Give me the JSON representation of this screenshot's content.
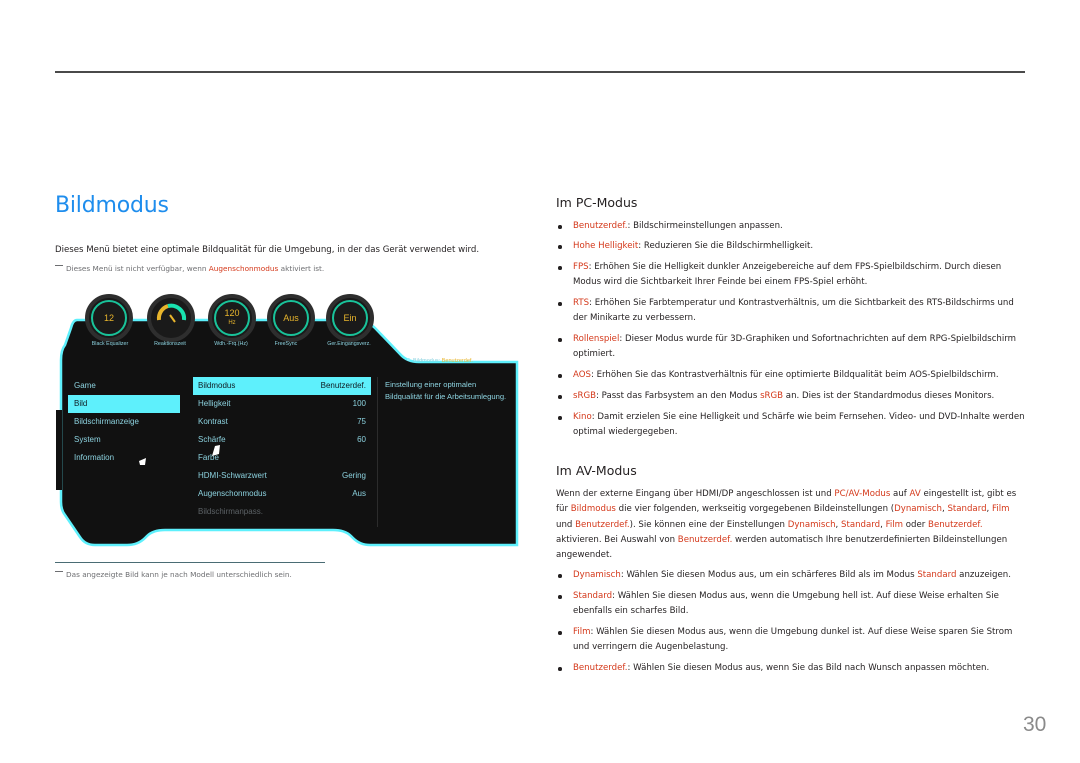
{
  "left": {
    "title": "Bildmodus",
    "intro": "Dieses Menü bietet eine optimale Bildqualität für die Umgebung, in der das Gerät verwendet wird.",
    "note": {
      "before": "Dieses Menü ist nicht verfügbar, wenn ",
      "highlight": "Augenschonmodus",
      "after": " aktiviert ist."
    },
    "footnote": "Das angezeigte Bild kann je nach Modell unterschiedlich sein."
  },
  "osd": {
    "dials": [
      {
        "value": "12",
        "unit": "",
        "label": "Black Equalizer",
        "icon": ""
      },
      {
        "value": "",
        "unit": "",
        "label": "Reaktionszeit",
        "icon": "gauge-icon"
      },
      {
        "value": "120",
        "unit": "Hz",
        "label": "Wdh.-Frq.(Hz)",
        "icon": ""
      },
      {
        "value": "Aus",
        "unit": "",
        "label": "FreeSync",
        "icon": ""
      },
      {
        "value": "Ein",
        "unit": "",
        "label": "Ger.Eingangsverz.",
        "icon": ""
      }
    ],
    "status": {
      "label": "Bildmodus:",
      "value": "Benutzerdef."
    },
    "categories": [
      {
        "label": "Game",
        "selected": false
      },
      {
        "label": "Bild",
        "selected": true
      },
      {
        "label": "Bildschirmanzeige",
        "selected": false
      },
      {
        "label": "System",
        "selected": false
      },
      {
        "label": "Information",
        "selected": false
      }
    ],
    "settings": [
      {
        "label": "Bildmodus",
        "value": "Benutzerdef.",
        "selected": true,
        "disabled": false
      },
      {
        "label": "Helligkeit",
        "value": "100",
        "selected": false,
        "disabled": false
      },
      {
        "label": "Kontrast",
        "value": "75",
        "selected": false,
        "disabled": false
      },
      {
        "label": "Schärfe",
        "value": "60",
        "selected": false,
        "disabled": false
      },
      {
        "label": "Farbe",
        "value": "",
        "selected": false,
        "disabled": false
      },
      {
        "label": "HDMI-Schwarzwert",
        "value": "Gering",
        "selected": false,
        "disabled": false
      },
      {
        "label": "Augenschonmodus",
        "value": "Aus",
        "selected": false,
        "disabled": false
      },
      {
        "label": "Bildschirmanpass.",
        "value": "",
        "selected": false,
        "disabled": true
      }
    ],
    "description": "Einstellung einer optimalen Bildqualität für die Arbeitsumlegung.",
    "colors": {
      "accent": "#5ef0fc",
      "ring": "#19c39a",
      "value": "#e8b52c",
      "text": "#8dd3e0",
      "bg": "#111111"
    }
  },
  "pc_mode": {
    "heading": "Im PC-Modus",
    "items": [
      {
        "term": "Benutzerdef.",
        "text": ": Bildschirmeinstellungen anpassen."
      },
      {
        "term": "Hohe Helligkeit",
        "text": ": Reduzieren Sie die Bildschirmhelligkeit."
      },
      {
        "term": "FPS",
        "text": ": Erhöhen Sie die Helligkeit dunkler Anzeigebereiche auf dem FPS-Spielbildschirm. Durch diesen Modus wird die Sichtbarkeit Ihrer Feinde bei einem FPS-Spiel erhöht."
      },
      {
        "term": "RTS",
        "text": ": Erhöhen Sie Farbtemperatur und Kontrastverhältnis, um die Sichtbarkeit des RTS-Bildschirms und der Minikarte zu verbessern."
      },
      {
        "term": "Rollenspiel",
        "text": ": Dieser Modus wurde für 3D-Graphiken und Sofortnachrichten auf dem RPG-Spielbildschirm optimiert."
      },
      {
        "term": "AOS",
        "text": ": Erhöhen Sie das Kontrastverhältnis für eine optimierte Bildqualität beim AOS-Spielbildschirm."
      },
      {
        "term": "sRGB",
        "text": ": Passt das Farbsystem an den Modus ",
        "term2": "sRGB",
        "text2": " an. Dies ist der Standardmodus dieses Monitors."
      },
      {
        "term": "Kino",
        "text": ": Damit erzielen Sie eine Helligkeit und Schärfe wie beim Fernsehen. Video- und DVD-Inhalte werden optimal wiedergegeben."
      }
    ]
  },
  "av_mode": {
    "heading": "Im AV-Modus",
    "paragraph": [
      {
        "t": "Wenn der externe Eingang über HDMI/DP angeschlossen ist und ",
        "r": false
      },
      {
        "t": "PC/AV-Modus",
        "r": true
      },
      {
        "t": " auf ",
        "r": false
      },
      {
        "t": "AV",
        "r": true
      },
      {
        "t": " eingestellt ist, gibt es für ",
        "r": false
      },
      {
        "t": "Bildmodus",
        "r": true
      },
      {
        "t": " die vier folgenden, werkseitig vorgegebenen Bildeinstellungen (",
        "r": false
      },
      {
        "t": "Dynamisch",
        "r": true
      },
      {
        "t": ", ",
        "r": false
      },
      {
        "t": "Standard",
        "r": true
      },
      {
        "t": ", ",
        "r": false
      },
      {
        "t": "Film",
        "r": true
      },
      {
        "t": " und ",
        "r": false
      },
      {
        "t": "Benutzerdef.",
        "r": true
      },
      {
        "t": "). Sie können eine der Einstellungen ",
        "r": false
      },
      {
        "t": "Dynamisch",
        "r": true
      },
      {
        "t": ", ",
        "r": false
      },
      {
        "t": "Standard",
        "r": true
      },
      {
        "t": ", ",
        "r": false
      },
      {
        "t": "Film",
        "r": true
      },
      {
        "t": " oder ",
        "r": false
      },
      {
        "t": "Benutzerdef.",
        "r": true
      },
      {
        "t": " aktivieren. Bei Auswahl von ",
        "r": false
      },
      {
        "t": "Benutzerdef.",
        "r": true
      },
      {
        "t": " werden automatisch Ihre benutzerdefinierten Bildeinstellungen angewendet.",
        "r": false
      }
    ],
    "items": [
      {
        "term": "Dynamisch",
        "text": ": Wählen Sie diesen Modus aus, um ein schärferes Bild als im Modus ",
        "term2": "Standard",
        "text2": " anzuzeigen."
      },
      {
        "term": "Standard",
        "text": ": Wählen Sie diesen Modus aus, wenn die Umgebung hell ist. Auf diese Weise erhalten Sie ebenfalls ein scharfes Bild."
      },
      {
        "term": "Film",
        "text": ": Wählen Sie diesen Modus aus, wenn die Umgebung dunkel ist. Auf diese Weise sparen Sie Strom und verringern die Augenbelastung."
      },
      {
        "term": "Benutzerdef.",
        "text": ": Wählen Sie diesen Modus aus, wenn Sie das Bild nach Wunsch anpassen möchten."
      }
    ]
  },
  "page_number": "30",
  "colors": {
    "title": "#1e8ded",
    "highlight": "#d4381a",
    "body": "#231f20",
    "muted": "#6d6e71"
  }
}
